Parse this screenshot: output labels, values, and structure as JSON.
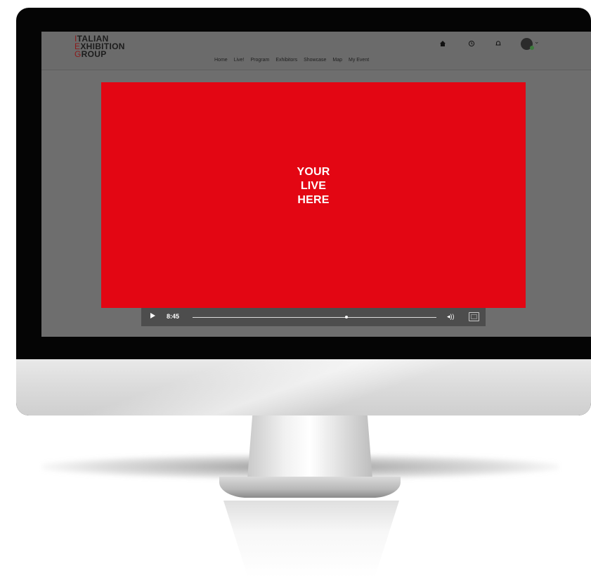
{
  "logo": {
    "line1_accent": "I",
    "line1_rest": "TALIAN",
    "line2_accent": "E",
    "line2_rest": "XHIBITION",
    "line3_accent": "G",
    "line3_rest": "ROUP"
  },
  "nav": {
    "items": [
      "Home",
      "Live!",
      "Program",
      "Exhibitors",
      "Showcase",
      "Map",
      "My Event"
    ],
    "icons": [
      "home-icon",
      "history-icon",
      "notification-bell-icon",
      "avatar",
      "chevron-down-icon"
    ]
  },
  "video": {
    "overlay_text": "YOUR\nLIVE\nHERE",
    "background_color": "#e30613",
    "time": "8:45",
    "progress": 0.63
  }
}
